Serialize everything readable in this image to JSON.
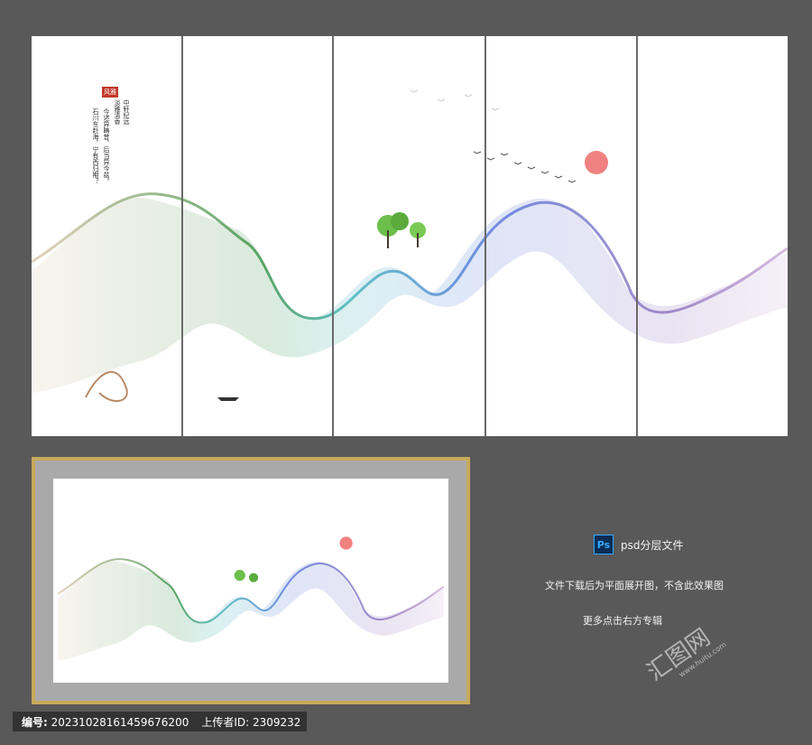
{
  "preview": {
    "seal_text": "风雅",
    "poem_columns": [
      "中轩纪远",
      "淡雅清香",
      "今述异畴昔，后当异今兹。",
      "石川东赴海，宁有西归期？"
    ]
  },
  "sidebar": {
    "ps_badge": "Ps",
    "ps_label": "psd分层文件",
    "note_download": "文件下载后为平面展开图，不含此效果图",
    "note_more": "更多点击右方专辑"
  },
  "watermark": {
    "logo_text": "汇图网",
    "site_text": "www.huitu.com"
  },
  "footer": {
    "id_label": "编号:",
    "id_value": "20231028161459676200",
    "uploader_label": "上传者ID:",
    "uploader_value": "2309232"
  },
  "colors": {
    "background": "#595959",
    "frame_gold": "#c7a95a",
    "ink_green": "#2e8b3a",
    "ink_blue": "#4a6fd6",
    "ink_purple": "#8b6bb8",
    "sun_red": "#ef6b6b"
  }
}
